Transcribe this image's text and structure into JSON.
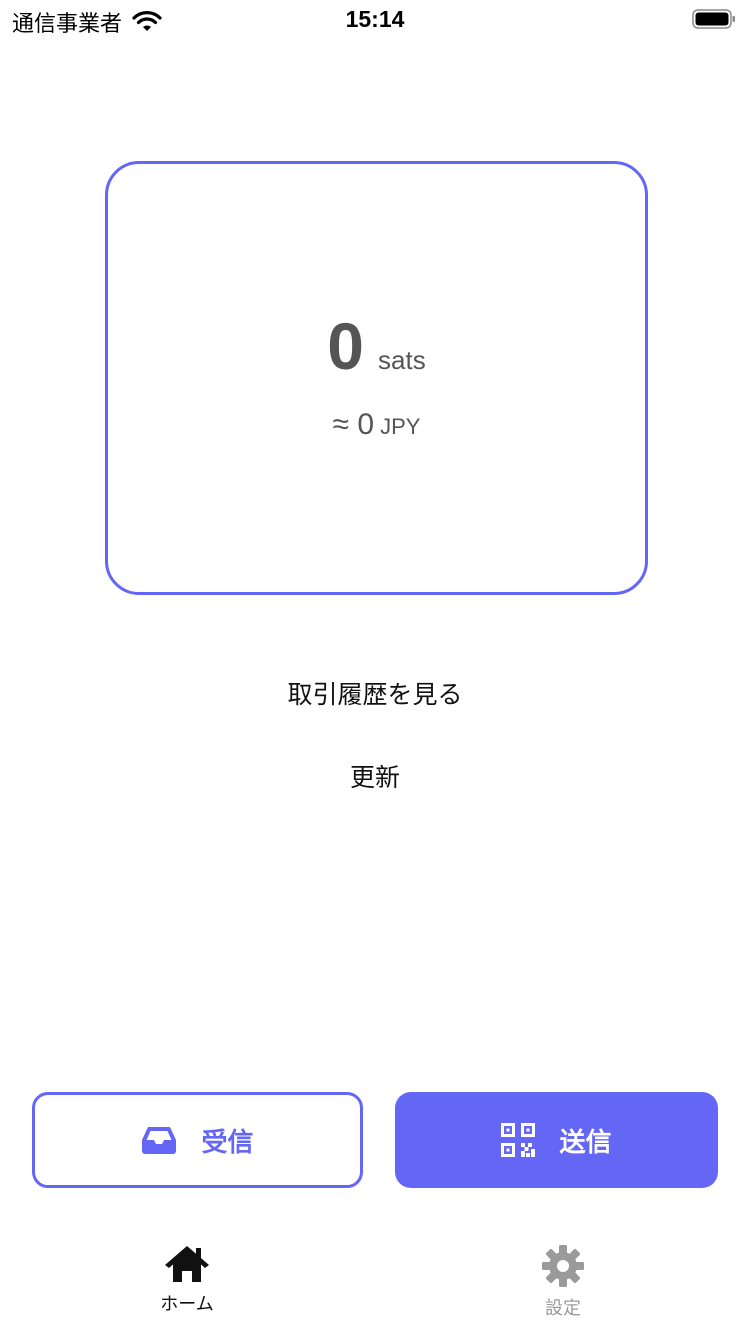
{
  "status_bar": {
    "carrier": "通信事業者",
    "time": "15:14"
  },
  "balance": {
    "amount": "0",
    "unit": "sats",
    "fiat_amount": "≈ 0",
    "fiat_unit": "JPY"
  },
  "links": {
    "history": "取引履歴を見る",
    "refresh": "更新"
  },
  "buttons": {
    "receive": {
      "label": "受信",
      "icon": "inbox-icon"
    },
    "send": {
      "label": "送信",
      "icon": "qr-code-icon"
    }
  },
  "tab_bar": {
    "home": {
      "label": "ホーム",
      "icon": "home-icon",
      "active": true
    },
    "settings": {
      "label": "設定",
      "icon": "gear-icon",
      "active": false
    }
  },
  "colors": {
    "accent": "#6466f5",
    "inactive_tab": "#9a9a9a"
  }
}
